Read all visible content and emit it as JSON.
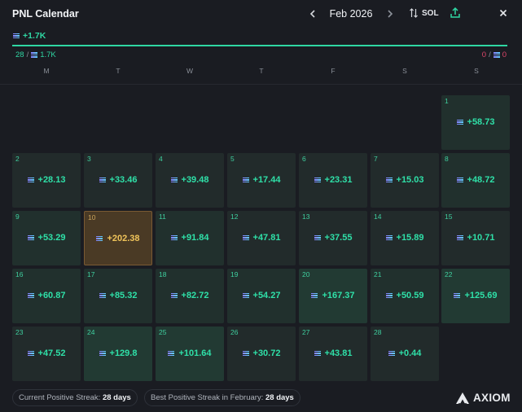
{
  "header": {
    "title": "PNL Calendar",
    "month": "Feb 2026",
    "prev_icon": "chevron-left-icon",
    "next_icon": "chevron-right-icon",
    "unit_label": "SOL",
    "unit_icon": "swap-vertical-icon",
    "share_icon": "share-upload-icon",
    "close_icon": "close-icon"
  },
  "summary": {
    "total": "+1.7K",
    "profit_days": "28",
    "profit_sep": "/",
    "profit_amount": "1.7K",
    "loss_days": "0",
    "loss_sep": "/",
    "loss_amount": "0"
  },
  "weekdays": [
    "M",
    "T",
    "W",
    "T",
    "F",
    "S",
    "S"
  ],
  "days": [
    {
      "day": "1",
      "value": "+58.73"
    },
    {
      "day": "2",
      "value": "+28.13"
    },
    {
      "day": "3",
      "value": "+33.46"
    },
    {
      "day": "4",
      "value": "+39.48"
    },
    {
      "day": "5",
      "value": "+17.44"
    },
    {
      "day": "6",
      "value": "+23.31"
    },
    {
      "day": "7",
      "value": "+15.03"
    },
    {
      "day": "8",
      "value": "+48.72"
    },
    {
      "day": "9",
      "value": "+53.29"
    },
    {
      "day": "10",
      "value": "+202.38"
    },
    {
      "day": "11",
      "value": "+91.84"
    },
    {
      "day": "12",
      "value": "+47.81"
    },
    {
      "day": "13",
      "value": "+37.55"
    },
    {
      "day": "14",
      "value": "+15.89"
    },
    {
      "day": "15",
      "value": "+10.71"
    },
    {
      "day": "16",
      "value": "+60.87"
    },
    {
      "day": "17",
      "value": "+85.32"
    },
    {
      "day": "18",
      "value": "+82.72"
    },
    {
      "day": "19",
      "value": "+54.27"
    },
    {
      "day": "20",
      "value": "+167.37"
    },
    {
      "day": "21",
      "value": "+50.59"
    },
    {
      "day": "22",
      "value": "+125.69"
    },
    {
      "day": "23",
      "value": "+47.52"
    },
    {
      "day": "24",
      "value": "+129.8"
    },
    {
      "day": "25",
      "value": "+101.64"
    },
    {
      "day": "26",
      "value": "+30.72"
    },
    {
      "day": "27",
      "value": "+43.81"
    },
    {
      "day": "28",
      "value": "+0.44"
    }
  ],
  "footer": {
    "current_streak_label": "Current Positive Streak:",
    "current_streak_value": "28 days",
    "best_streak_label": "Best Positive Streak in February:",
    "best_streak_value": "28 days",
    "brand": "AXIOM"
  },
  "colors": {
    "accent": "#2fd6a3",
    "loss": "#e0466a",
    "best_day": "#f0c45a"
  }
}
